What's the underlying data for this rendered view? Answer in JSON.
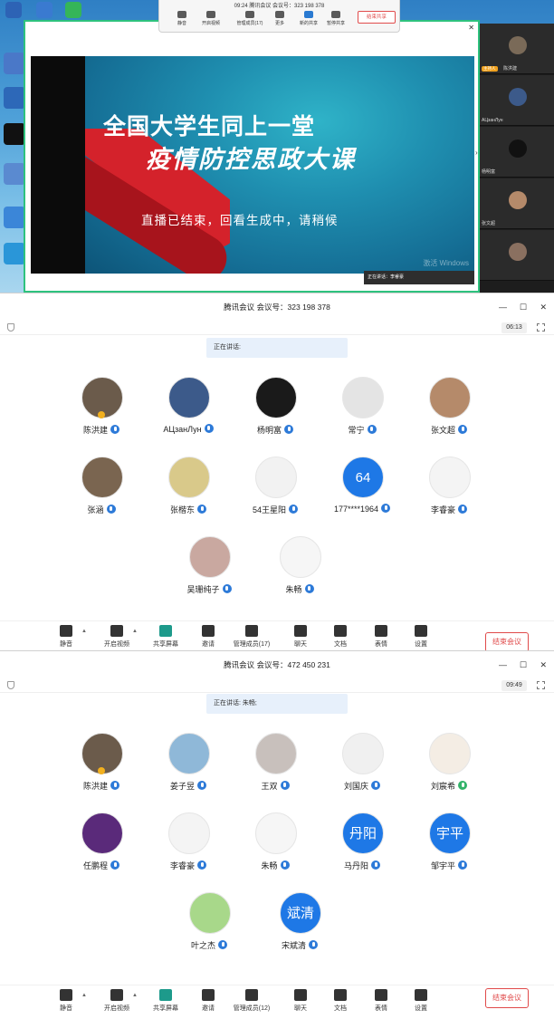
{
  "panel1": {
    "float_toolbar": {
      "title": "09:24  腾讯会议 会议号：323 198 378",
      "items": [
        "静音",
        "开启视频",
        "管理成员(17)",
        "更多",
        "新的共享",
        "暂停共享"
      ],
      "end_label": "结束共享"
    },
    "slide": {
      "line1": "全国大学生同上一堂",
      "line2": "疫情防控思政大课",
      "line3": "直播已结束，回看生成中，请稍候",
      "watermark": "激活 Windows"
    },
    "speaking": "正在讲话：李睿豪",
    "thumbnails": [
      "陈洪建",
      "AЦзанЛун",
      "杨明富",
      "张文超",
      ""
    ],
    "host_badge": "主持人"
  },
  "panel2": {
    "title": "腾讯会议 会议号：323 198 378",
    "timer": "06:13",
    "speaking": "正在讲话:",
    "participants": [
      {
        "name": "陈洪建",
        "avatar_color": "#6b5b4b"
      },
      {
        "name": "AЦзанЛун",
        "avatar_color": "#3c5a8a"
      },
      {
        "name": "杨明富",
        "avatar_color": "#1a1a1a"
      },
      {
        "name": "常宁",
        "avatar_color": "#e4e4e4"
      },
      {
        "name": "张文超",
        "avatar_color": "#b58a6a"
      },
      {
        "name": "张涵",
        "avatar_color": "#7a6550"
      },
      {
        "name": "张楷东",
        "avatar_color": "#d9c98a"
      },
      {
        "name": "54王星阳",
        "avatar_color": "#f2f2f2"
      },
      {
        "name": "177****1964",
        "avatar_text": "64",
        "avatar_color": "#1e78e6"
      },
      {
        "name": "李睿豪",
        "avatar_color": "#f4f4f4"
      },
      {
        "name": "吴珊纯子",
        "avatar_color": "#c9a8a0"
      },
      {
        "name": "朱畅",
        "avatar_color": "#f6f6f6"
      }
    ],
    "toolbar": [
      "静音",
      "开启视频",
      "共享屏幕",
      "邀请",
      "管理成员(17)",
      "聊天",
      "文档",
      "表情",
      "设置"
    ],
    "end_label": "结束会议"
  },
  "panel3": {
    "title": "腾讯会议 会议号：472 450 231",
    "timer": "09:49",
    "speaking": "正在讲话: 朱畅;",
    "participants": [
      {
        "name": "陈洪建",
        "avatar_color": "#6b5b4b"
      },
      {
        "name": "姜子昱",
        "avatar_color": "#8fb8d8"
      },
      {
        "name": "王双",
        "avatar_color": "#c8c0bc"
      },
      {
        "name": "刘国庆",
        "avatar_color": "#f0f0f0"
      },
      {
        "name": "刘宸希",
        "avatar_color": "#f4ede4"
      },
      {
        "name": "任鹏程",
        "avatar_color": "#5a2a7a"
      },
      {
        "name": "李睿豪",
        "avatar_color": "#f4f4f4"
      },
      {
        "name": "朱畅",
        "avatar_color": "#f6f6f6"
      },
      {
        "name": "马丹阳",
        "avatar_text": "丹阳",
        "avatar_color": "#1e78e6"
      },
      {
        "name": "邹宇平",
        "avatar_text": "宇平",
        "avatar_color": "#1e78e6"
      },
      {
        "name": "叶之杰",
        "avatar_color": "#a8d88a"
      },
      {
        "name": "宋斌清",
        "avatar_text": "斌清",
        "avatar_color": "#1e78e6"
      }
    ],
    "toolbar": [
      "静音",
      "开启视频",
      "共享屏幕",
      "邀请",
      "管理成员(12)",
      "聊天",
      "文档",
      "表情",
      "设置"
    ],
    "end_label": "结束会议"
  }
}
